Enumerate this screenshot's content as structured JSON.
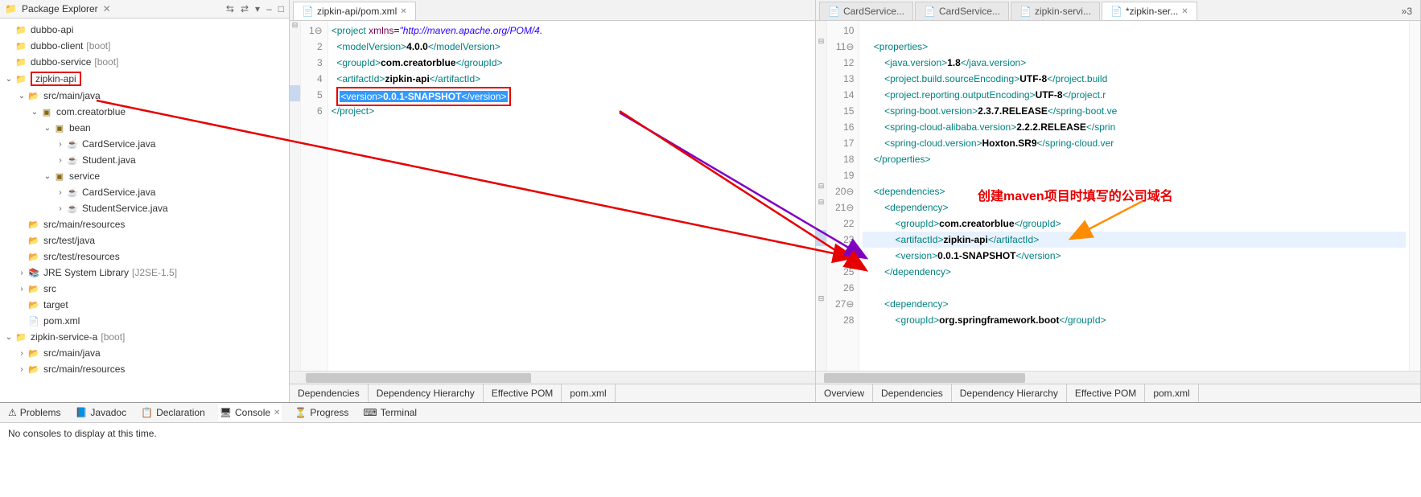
{
  "package_explorer": {
    "title": "Package Explorer",
    "tree": [
      {
        "indent": 0,
        "exp": "",
        "icon": "proj",
        "label": "dubbo-api",
        "suffix": ""
      },
      {
        "indent": 0,
        "exp": "",
        "icon": "proj",
        "label": "dubbo-client",
        "suffix": "[boot]"
      },
      {
        "indent": 0,
        "exp": "",
        "icon": "proj",
        "label": "dubbo-service",
        "suffix": "[boot]"
      },
      {
        "indent": 0,
        "exp": "v",
        "icon": "proj",
        "label": "zipkin-api",
        "suffix": "",
        "redbox": true
      },
      {
        "indent": 1,
        "exp": "v",
        "icon": "fold",
        "label": "src/main/java",
        "suffix": ""
      },
      {
        "indent": 2,
        "exp": "v",
        "icon": "pkg",
        "label": "com.creatorblue",
        "suffix": ""
      },
      {
        "indent": 3,
        "exp": "v",
        "icon": "pkg",
        "label": "bean",
        "suffix": ""
      },
      {
        "indent": 4,
        "exp": ">",
        "icon": "java",
        "label": "CardService.java",
        "suffix": ""
      },
      {
        "indent": 4,
        "exp": ">",
        "icon": "java",
        "label": "Student.java",
        "suffix": ""
      },
      {
        "indent": 3,
        "exp": "v",
        "icon": "pkg",
        "label": "service",
        "suffix": ""
      },
      {
        "indent": 4,
        "exp": ">",
        "icon": "java",
        "label": "CardService.java",
        "suffix": ""
      },
      {
        "indent": 4,
        "exp": ">",
        "icon": "java",
        "label": "StudentService.java",
        "suffix": ""
      },
      {
        "indent": 1,
        "exp": "",
        "icon": "fold",
        "label": "src/main/resources",
        "suffix": ""
      },
      {
        "indent": 1,
        "exp": "",
        "icon": "fold",
        "label": "src/test/java",
        "suffix": ""
      },
      {
        "indent": 1,
        "exp": "",
        "icon": "fold",
        "label": "src/test/resources",
        "suffix": ""
      },
      {
        "indent": 1,
        "exp": ">",
        "icon": "lib",
        "label": "JRE System Library",
        "suffix": "[J2SE-1.5]"
      },
      {
        "indent": 1,
        "exp": ">",
        "icon": "fold",
        "label": "src",
        "suffix": ""
      },
      {
        "indent": 1,
        "exp": "",
        "icon": "fold",
        "label": "target",
        "suffix": ""
      },
      {
        "indent": 1,
        "exp": "",
        "icon": "xml",
        "label": "pom.xml",
        "suffix": ""
      },
      {
        "indent": 0,
        "exp": "v",
        "icon": "proj",
        "label": "zipkin-service-a",
        "suffix": "[boot]"
      },
      {
        "indent": 1,
        "exp": ">",
        "icon": "fold",
        "label": "src/main/java",
        "suffix": ""
      },
      {
        "indent": 1,
        "exp": ">",
        "icon": "fold",
        "label": "src/main/resources",
        "suffix": ""
      }
    ]
  },
  "left_editor": {
    "tab": "zipkin-api/pom.xml",
    "lines": [
      {
        "n": "1",
        "fold": "-",
        "html": "<span class='tag'>&lt;project</span> <span class='attr'>xmlns</span>=<span class='val'>\"http://maven.apache.org/POM/4.</span>"
      },
      {
        "n": "2",
        "html": "  <span class='tag'>&lt;modelVersion&gt;</span><span class='txt'>4.0.0</span><span class='tag'>&lt;/modelVersion&gt;</span>"
      },
      {
        "n": "3",
        "html": "  <span class='tag'>&lt;groupId&gt;</span><span class='txt'>com.creatorblue</span><span class='tag'>&lt;/groupId&gt;</span>"
      },
      {
        "n": "4",
        "html": "  <span class='tag'>&lt;artifactId&gt;</span><span class='txt'>zipkin-api</span><span class='tag'>&lt;/artifactId&gt;</span>"
      },
      {
        "n": "5",
        "html": "  <span class='red-box-code'><span class='highlight-sel'><span class='tag'>&lt;version&gt;</span><span class='txt'>0.0.1-SNAPSHOT</span><span class='tag'>&lt;/version&gt;</span></span></span>",
        "mark": true
      },
      {
        "n": "6",
        "html": "<span class='tag'>&lt;/project&gt;</span>"
      }
    ],
    "bottom_tabs": [
      "Dependencies",
      "Dependency Hierarchy",
      "Effective POM",
      "pom.xml"
    ]
  },
  "right_editor": {
    "tabs": [
      {
        "label": "CardService...",
        "active": false
      },
      {
        "label": "CardService...",
        "active": false
      },
      {
        "label": "zipkin-servi...",
        "active": false
      },
      {
        "label": "*zipkin-ser...",
        "active": true
      }
    ],
    "overflow": "»3",
    "lines": [
      {
        "n": "10",
        "html": ""
      },
      {
        "n": "11",
        "fold": "-",
        "html": "    <span class='tag'>&lt;properties&gt;</span>"
      },
      {
        "n": "12",
        "html": "        <span class='tag'>&lt;java.version&gt;</span><span class='txt'>1.8</span><span class='tag'>&lt;/java.version&gt;</span>"
      },
      {
        "n": "13",
        "html": "        <span class='tag'>&lt;project.build.sourceEncoding&gt;</span><span class='txt'>UTF-8</span><span class='tag'>&lt;/project.build</span>"
      },
      {
        "n": "14",
        "html": "        <span class='tag'>&lt;project.reporting.outputEncoding&gt;</span><span class='txt'>UTF-8</span><span class='tag'>&lt;/project.r</span>"
      },
      {
        "n": "15",
        "html": "        <span class='tag'>&lt;spring-boot.version&gt;</span><span class='txt'>2.3.7.RELEASE</span><span class='tag'>&lt;/spring-boot.ve</span>"
      },
      {
        "n": "16",
        "html": "        <span class='tag'>&lt;spring-cloud-alibaba.version&gt;</span><span class='txt'>2.2.2.RELEASE</span><span class='tag'>&lt;/sprin</span>"
      },
      {
        "n": "17",
        "html": "        <span class='tag'>&lt;spring-cloud.version&gt;</span><span class='txt'>Hoxton.SR9</span><span class='tag'>&lt;/spring-cloud.ver</span>"
      },
      {
        "n": "18",
        "html": "    <span class='tag'>&lt;/properties&gt;</span>"
      },
      {
        "n": "19",
        "html": ""
      },
      {
        "n": "20",
        "fold": "-",
        "html": "    <span class='tag'>&lt;dependencies&gt;</span>"
      },
      {
        "n": "21",
        "fold": "-",
        "html": "        <span class='tag'>&lt;dependency&gt;</span>"
      },
      {
        "n": "22",
        "html": "            <span class='tag'>&lt;groupId&gt;</span><span class='txt'>com.creatorblue</span><span class='tag'>&lt;/groupId&gt;</span>"
      },
      {
        "n": "23",
        "html": "            <span class='tag'>&lt;artifactId&gt;</span><span class='txt'>zipkin-api</span><span class='tag'>&lt;/artifactId&gt;</span>",
        "hl": true,
        "mark": true
      },
      {
        "n": "24",
        "html": "            <span class='tag'>&lt;version&gt;</span><span class='txt'>0.0.1-SNAPSHOT</span><span class='tag'>&lt;/version&gt;</span>"
      },
      {
        "n": "25",
        "html": "        <span class='tag'>&lt;/dependency&gt;</span>"
      },
      {
        "n": "26",
        "html": ""
      },
      {
        "n": "27",
        "fold": "-",
        "html": "        <span class='tag'>&lt;dependency&gt;</span>"
      },
      {
        "n": "28",
        "html": "            <span class='tag'>&lt;groupId&gt;</span><span class='txt'>org.springframework.boot</span><span class='tag'>&lt;/groupId&gt;</span>"
      }
    ],
    "bottom_tabs": [
      "Overview",
      "Dependencies",
      "Dependency Hierarchy",
      "Effective POM",
      "pom.xml"
    ]
  },
  "console": {
    "tabs": [
      "Problems",
      "Javadoc",
      "Declaration",
      "Console",
      "Progress",
      "Terminal"
    ],
    "active_index": 3,
    "body": "No consoles to display at this time."
  },
  "annotation_text": "创建maven项目时填写的公司域名"
}
